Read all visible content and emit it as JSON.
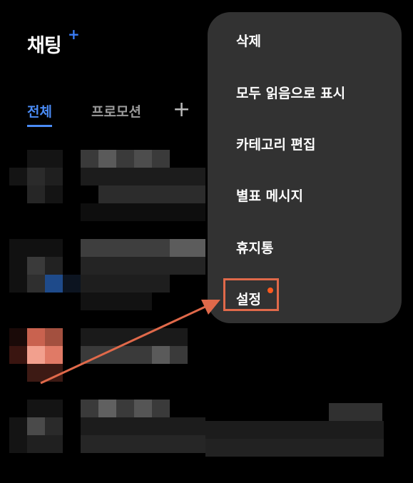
{
  "header": {
    "title": "채팅",
    "title_plus": "+"
  },
  "tabs": [
    {
      "label": "전체",
      "selected": true
    },
    {
      "label": "프로모션",
      "selected": false
    }
  ],
  "add_tab_symbol": "+",
  "context_menu": {
    "items": [
      {
        "label": "삭제"
      },
      {
        "label": "모두 읽음으로 표시"
      },
      {
        "label": "카테고리 편집"
      },
      {
        "label": "별표 메시지"
      },
      {
        "label": "휴지통"
      },
      {
        "label": "설정"
      }
    ],
    "highlighted_item": "설정",
    "notification_dot_color": "#ff5a1f"
  },
  "colors": {
    "accent": "#4a8bf5",
    "annotation": "#e0694a",
    "menu_bg": "#323232"
  }
}
